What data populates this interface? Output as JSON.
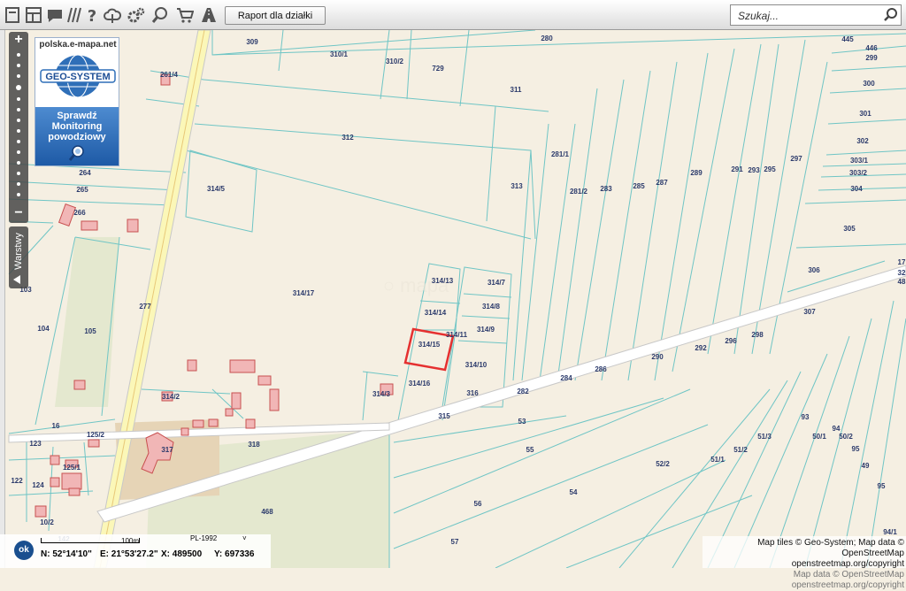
{
  "toolbar": {
    "tools": [
      {
        "name": "print-icon"
      },
      {
        "name": "layout-icon"
      },
      {
        "name": "speech-bubble-icon"
      },
      {
        "name": "hatch-icon"
      },
      {
        "name": "help-icon"
      },
      {
        "name": "cloud-icon"
      },
      {
        "name": "gears-icon"
      },
      {
        "name": "zoom-tool-icon"
      },
      {
        "name": "cart-icon"
      },
      {
        "name": "road-icon"
      }
    ],
    "report_button": "Raport dla działki",
    "search_placeholder": "Szukaj..."
  },
  "map": {
    "layers_tab": "Warstwy",
    "promo": {
      "site": "polska.e-mapa.net",
      "logo": "GEO-SYSTEM",
      "line1": "Sprawdź",
      "line2": "Monitoring",
      "line3": "powodziowy"
    },
    "plots": [
      {
        "id": "p280",
        "label": "280"
      },
      {
        "id": "p309",
        "label": "309"
      },
      {
        "id": "p310-1",
        "label": "310/1"
      },
      {
        "id": "p310-2",
        "label": "310/2"
      },
      {
        "id": "p729",
        "label": "729"
      },
      {
        "id": "p311",
        "label": "311"
      },
      {
        "id": "p312",
        "label": "312"
      },
      {
        "id": "p313",
        "label": "313"
      },
      {
        "id": "p261-4",
        "label": "261/4"
      },
      {
        "id": "p264",
        "label": "264"
      },
      {
        "id": "p265",
        "label": "265"
      },
      {
        "id": "p266",
        "label": "266"
      },
      {
        "id": "p314-5",
        "label": "314/5"
      },
      {
        "id": "p281-1",
        "label": "281/1"
      },
      {
        "id": "p281-2",
        "label": "281/2"
      },
      {
        "id": "p283",
        "label": "283"
      },
      {
        "id": "p285",
        "label": "285"
      },
      {
        "id": "p287",
        "label": "287"
      },
      {
        "id": "p289",
        "label": "289"
      },
      {
        "id": "p291",
        "label": "291"
      },
      {
        "id": "p293",
        "label": "293"
      },
      {
        "id": "p295",
        "label": "295"
      },
      {
        "id": "p297",
        "label": "297"
      },
      {
        "id": "p445",
        "label": "445"
      },
      {
        "id": "p446",
        "label": "446"
      },
      {
        "id": "p299",
        "label": "299"
      },
      {
        "id": "p300",
        "label": "300"
      },
      {
        "id": "p301",
        "label": "301"
      },
      {
        "id": "p302",
        "label": "302"
      },
      {
        "id": "p303-1",
        "label": "303/1"
      },
      {
        "id": "p303-2",
        "label": "303/2"
      },
      {
        "id": "p304",
        "label": "304"
      },
      {
        "id": "p305",
        "label": "305"
      },
      {
        "id": "p306",
        "label": "306"
      },
      {
        "id": "p307",
        "label": "307"
      },
      {
        "id": "p17",
        "label": "17"
      },
      {
        "id": "p32",
        "label": "32"
      },
      {
        "id": "p48",
        "label": "48"
      },
      {
        "id": "p103",
        "label": "103"
      },
      {
        "id": "p104",
        "label": "104"
      },
      {
        "id": "p105",
        "label": "105"
      },
      {
        "id": "p277",
        "label": "277"
      },
      {
        "id": "p314-17",
        "label": "314/17"
      },
      {
        "id": "p314-13",
        "label": "314/13"
      },
      {
        "id": "p314-7",
        "label": "314/7"
      },
      {
        "id": "p314-14",
        "label": "314/14"
      },
      {
        "id": "p314-8",
        "label": "314/8"
      },
      {
        "id": "p314-9",
        "label": "314/9"
      },
      {
        "id": "p314-11",
        "label": "314/11"
      },
      {
        "id": "p314-15",
        "label": "314/15"
      },
      {
        "id": "p314-10",
        "label": "314/10"
      },
      {
        "id": "p314-16",
        "label": "314/16"
      },
      {
        "id": "p314-3",
        "label": "314/3"
      },
      {
        "id": "p314-2",
        "label": "314/2"
      },
      {
        "id": "p316",
        "label": "316"
      },
      {
        "id": "p282",
        "label": "282"
      },
      {
        "id": "p284",
        "label": "284"
      },
      {
        "id": "p286",
        "label": "286"
      },
      {
        "id": "p290",
        "label": "290"
      },
      {
        "id": "p292",
        "label": "292"
      },
      {
        "id": "p296",
        "label": "296"
      },
      {
        "id": "p298",
        "label": "298"
      },
      {
        "id": "p315",
        "label": "315"
      },
      {
        "id": "p53",
        "label": "53"
      },
      {
        "id": "p16",
        "label": "16"
      },
      {
        "id": "p125-2",
        "label": "125/2"
      },
      {
        "id": "p123",
        "label": "123"
      },
      {
        "id": "p317",
        "label": "317"
      },
      {
        "id": "p318",
        "label": "318"
      },
      {
        "id": "p125-1",
        "label": "125/1"
      },
      {
        "id": "p122",
        "label": "122"
      },
      {
        "id": "p124",
        "label": "124"
      },
      {
        "id": "p55",
        "label": "55"
      },
      {
        "id": "p52-2",
        "label": "52/2"
      },
      {
        "id": "p51-1",
        "label": "51/1"
      },
      {
        "id": "p51-2",
        "label": "51/2"
      },
      {
        "id": "p51-3",
        "label": "51/3"
      },
      {
        "id": "p50-1",
        "label": "50/1"
      },
      {
        "id": "p50-2",
        "label": "50/2"
      },
      {
        "id": "p93",
        "label": "93"
      },
      {
        "id": "p94",
        "label": "94"
      },
      {
        "id": "p95a",
        "label": "95"
      },
      {
        "id": "p49",
        "label": "49"
      },
      {
        "id": "p95b",
        "label": "95"
      },
      {
        "id": "p54",
        "label": "54"
      },
      {
        "id": "p56",
        "label": "56"
      },
      {
        "id": "p468",
        "label": "468"
      },
      {
        "id": "p10-2",
        "label": "10/2"
      },
      {
        "id": "p57",
        "label": "57"
      },
      {
        "id": "p94-1",
        "label": "94/1"
      },
      {
        "id": "p142",
        "label": "142"
      }
    ]
  },
  "scale": {
    "ok_label": "ok",
    "bar_label": "100m",
    "crs": "PL-1992",
    "crs_arrow": "˅",
    "lat": "N: 52°14'10\"",
    "lon": "E: 21°53'27.2\"",
    "x": "X: 489500",
    "y": "Y: 697336"
  },
  "attribution": {
    "line1": "Map tiles © Geo-System; Map data © OpenStreetMap",
    "line2": "openstreetmap.org/copyright",
    "line3": "Map data © OpenStreetMap openstreetmap.org/copyright"
  },
  "colors": {
    "background": "#f5efe2",
    "parcel_line": "#6fc5c5",
    "road_edge": "#c8c8c8",
    "main_road": "#fbf7b8",
    "building_fill": "#f1b6b6",
    "building_stroke": "#c85050",
    "highlight": "#e53030",
    "label": "#2b3a6b",
    "green_area": "#e4e8cf",
    "industrial": "#e6d4b6"
  }
}
